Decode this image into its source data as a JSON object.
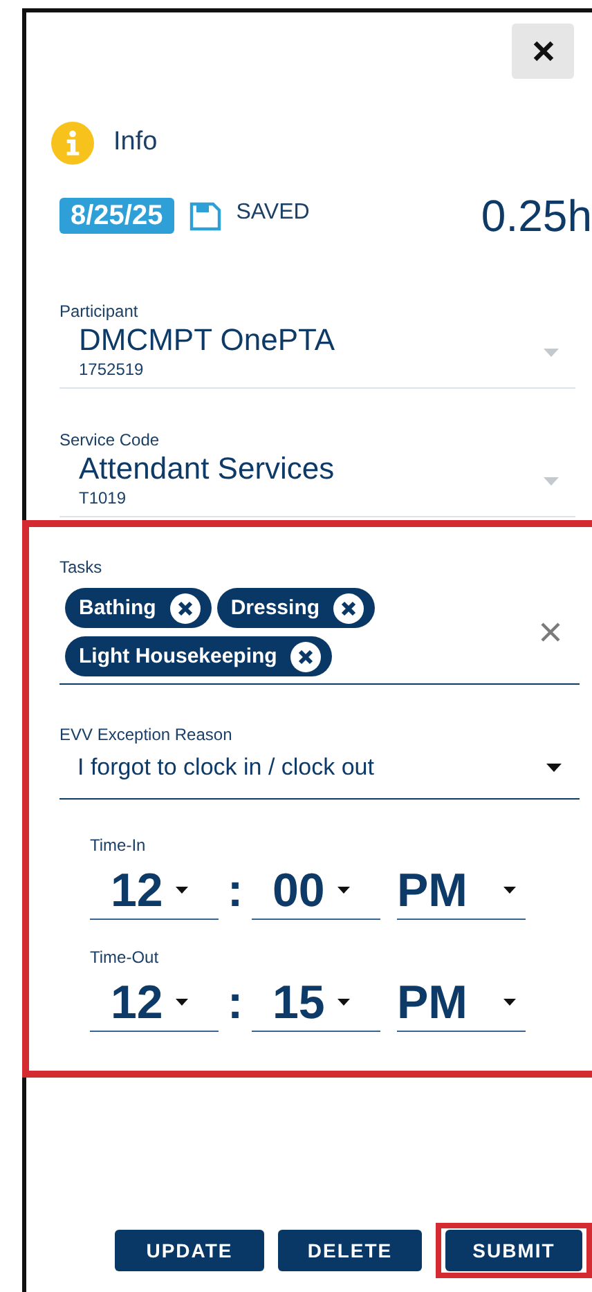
{
  "header": {
    "title": "Info"
  },
  "entry": {
    "date": "8/25/25",
    "status": "SAVED",
    "hours": "0.25h"
  },
  "fields": [
    {
      "label": "Participant",
      "value": "DMCMPT OnePTA",
      "sub": "1752519",
      "disabled": true
    },
    {
      "label": "Service Code",
      "value": "Attendant Services",
      "sub": "T1019",
      "disabled": true
    }
  ],
  "section": {
    "highlighted": true,
    "tasks": {
      "label": "Tasks",
      "chips": [
        "Bathing",
        "Dressing",
        "Light Housekeeping"
      ]
    },
    "exception": {
      "label": "EVV Exception Reason",
      "value": "I forgot to clock in / clock out"
    },
    "times": [
      {
        "label": "Time-In",
        "hour": "12",
        "separator": ":",
        "minute": "00",
        "period": "PM"
      },
      {
        "label": "Time-Out",
        "hour": "12",
        "separator": ":",
        "minute": "15",
        "period": "PM"
      }
    ]
  },
  "buttons": [
    {
      "label": "UPDATE",
      "highlighted": false
    },
    {
      "label": "DELETE",
      "highlighted": false
    },
    {
      "label": "SUBMIT",
      "highlighted": true
    }
  ]
}
